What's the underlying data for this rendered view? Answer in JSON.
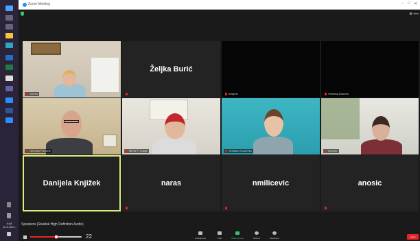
{
  "window": {
    "title": "Zoom Meeting",
    "controls": [
      "–",
      "□",
      "✕"
    ],
    "view_label": "View"
  },
  "taskbar": {
    "clock_time": "9:48",
    "clock_date": "16.5.2021."
  },
  "tiles": [
    {
      "name": "Valeria",
      "type": "video"
    },
    {
      "name": "Željka Burić",
      "type": "name"
    },
    {
      "name": "brajevic",
      "type": "dark"
    },
    {
      "name": "Vedrana Duković",
      "type": "dark"
    },
    {
      "name": "Nebojša Pavlović",
      "type": "video"
    },
    {
      "name": "Mirna P. Culjak",
      "type": "video"
    },
    {
      "name": "Svetlana Tkačenko",
      "type": "video"
    },
    {
      "name": "lmpavic",
      "type": "video"
    },
    {
      "name": "Danijela Knjižek",
      "type": "name"
    },
    {
      "name": "naras",
      "type": "name"
    },
    {
      "name": "nmilicevic",
      "type": "name"
    },
    {
      "name": "anosic",
      "type": "name"
    }
  ],
  "audio": {
    "device_label": "Speakers (Realtek High Definition Audio)",
    "volume": 22
  },
  "toolbar": {
    "participants_label": "Participants",
    "participants_count": "12",
    "chat_label": "Chat",
    "share_label": "Share Screen",
    "record_label": "Record",
    "reactions_label": "Reactions",
    "leave_label": "Leave"
  },
  "colors": {
    "accent": "#2d8cff",
    "active_speaker": "#d9ef7c",
    "leave": "#e02828",
    "share": "#38c172"
  }
}
